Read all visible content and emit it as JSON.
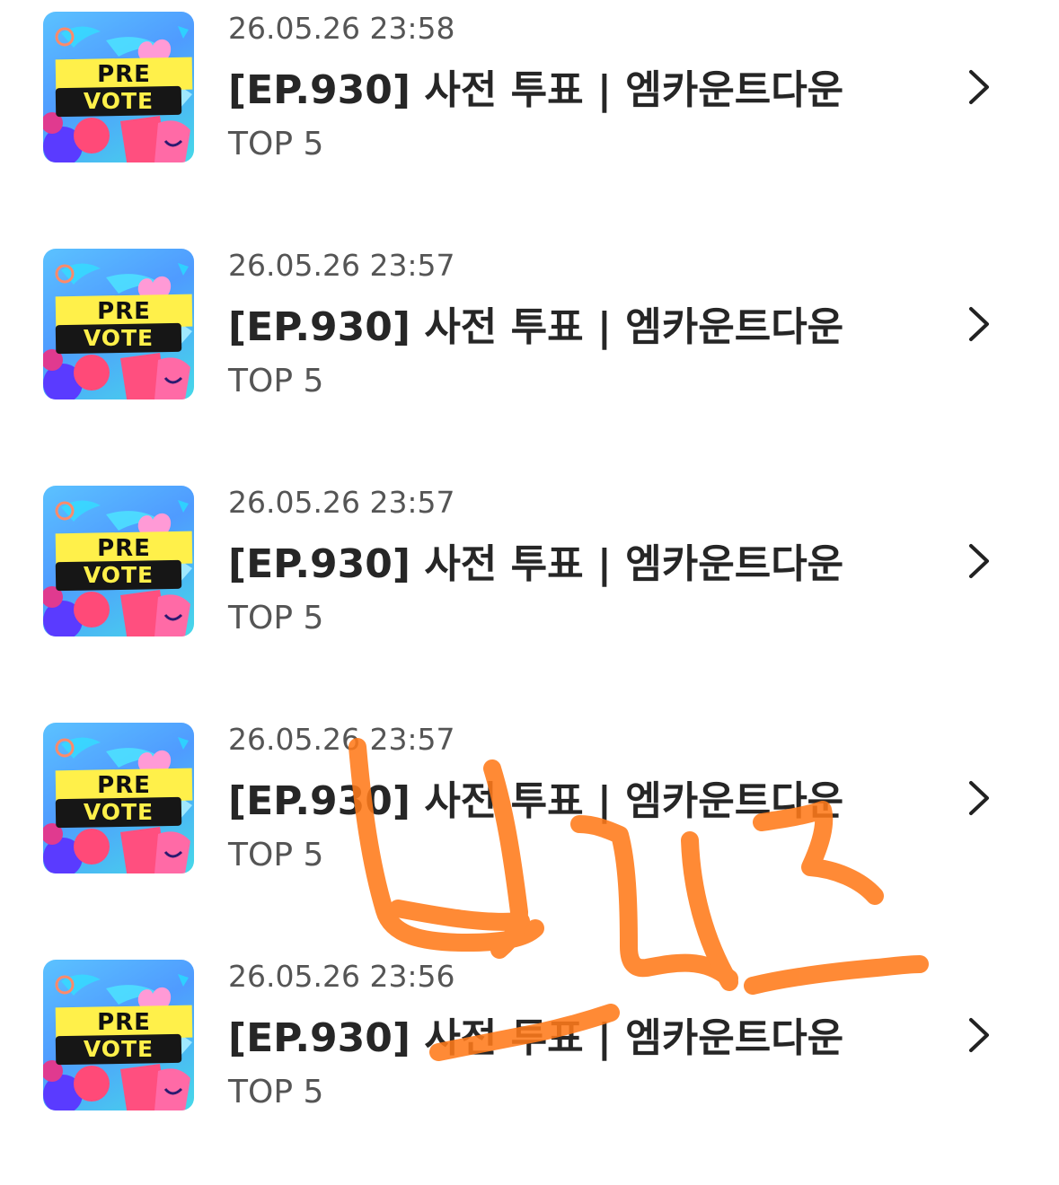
{
  "items": [
    {
      "time": "26.05.26 23:58",
      "title": "[EP.930] 사전 투표 | 엠카운트다운",
      "subtitle": "TOP 5",
      "thumb_top": "PRE",
      "thumb_bottom": "VOTE"
    },
    {
      "time": "26.05.26 23:57",
      "title": "[EP.930] 사전 투표 | 엠카운트다운",
      "subtitle": "TOP 5",
      "thumb_top": "PRE",
      "thumb_bottom": "VOTE"
    },
    {
      "time": "26.05.26 23:57",
      "title": "[EP.930] 사전 투표 | 엠카운트다운",
      "subtitle": "TOP 5",
      "thumb_top": "PRE",
      "thumb_bottom": "VOTE"
    },
    {
      "time": "26.05.26 23:57",
      "title": "[EP.930] 사전 투표 | 엠카운트다운",
      "subtitle": "TOP 5",
      "thumb_top": "PRE",
      "thumb_bottom": "VOTE"
    },
    {
      "time": "26.05.26 23:56",
      "title": "[EP.930] 사전 투표 | 엠카운트다운",
      "subtitle": "TOP 5",
      "thumb_top": "PRE",
      "thumb_bottom": "VOTE"
    }
  ],
  "icons": {
    "row_action": "chevron-right-icon",
    "thumbnail": "pre-vote-thumbnail"
  },
  "colors": {
    "annotation_stroke": "#ff7a1a",
    "thumbnail_yellow": "#fff04a",
    "thumbnail_black": "#161616",
    "text_primary": "#262626",
    "text_secondary": "#555555"
  }
}
